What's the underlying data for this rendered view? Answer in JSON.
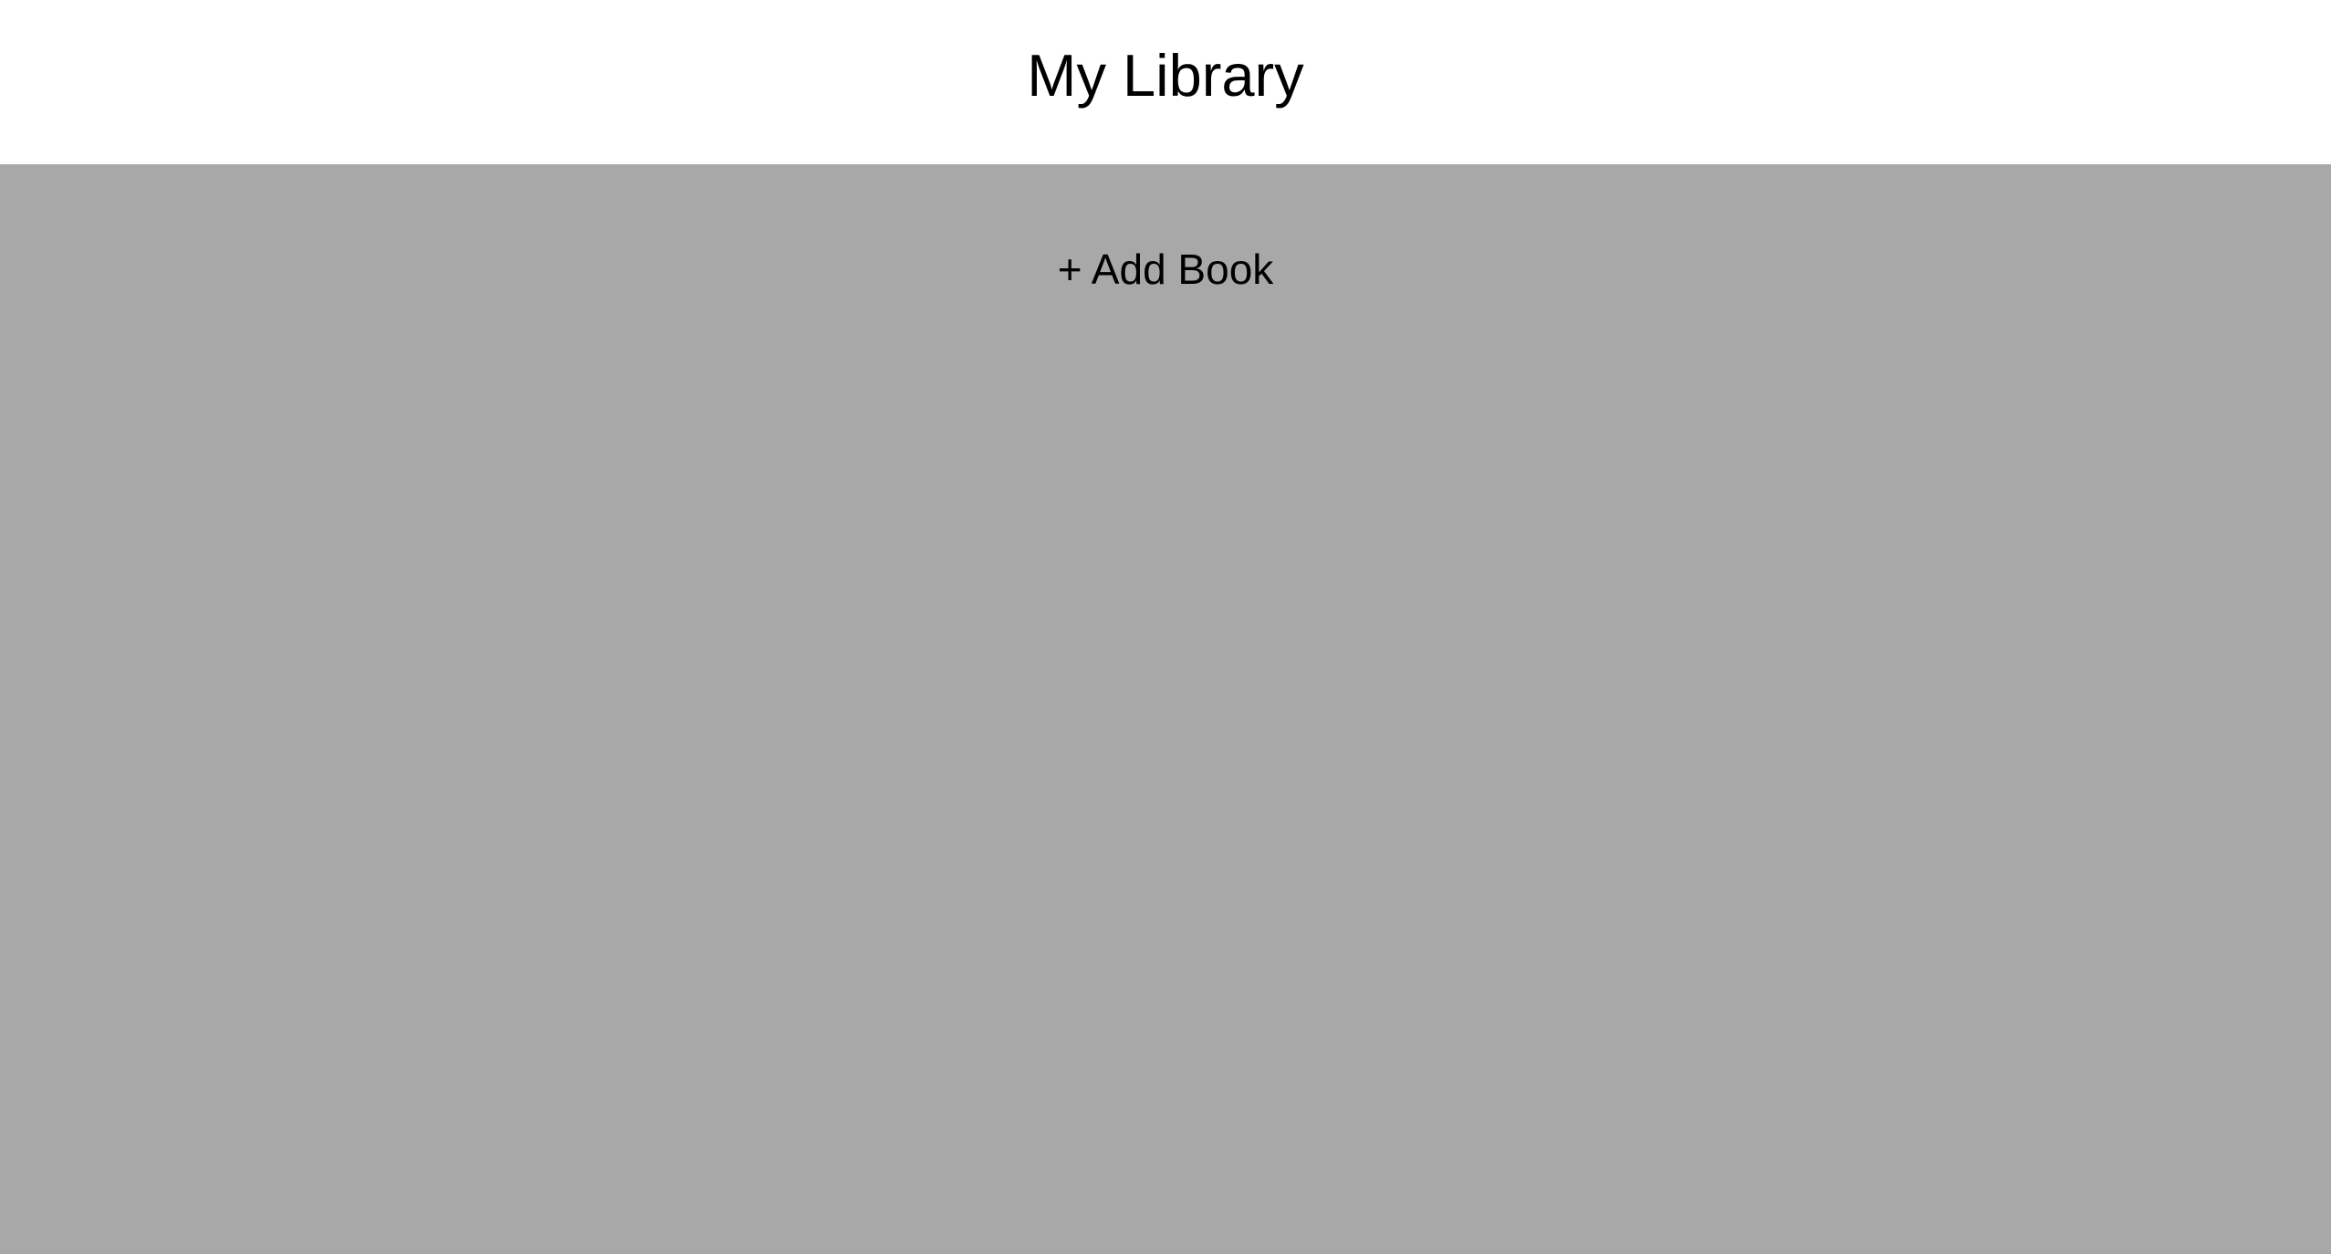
{
  "header": {
    "title": "My Library"
  },
  "main": {
    "add_book_label": "+ Add Book"
  },
  "colors": {
    "header_bg": "#ffffff",
    "main_bg": "#a8a8a8",
    "text": "#000000"
  }
}
